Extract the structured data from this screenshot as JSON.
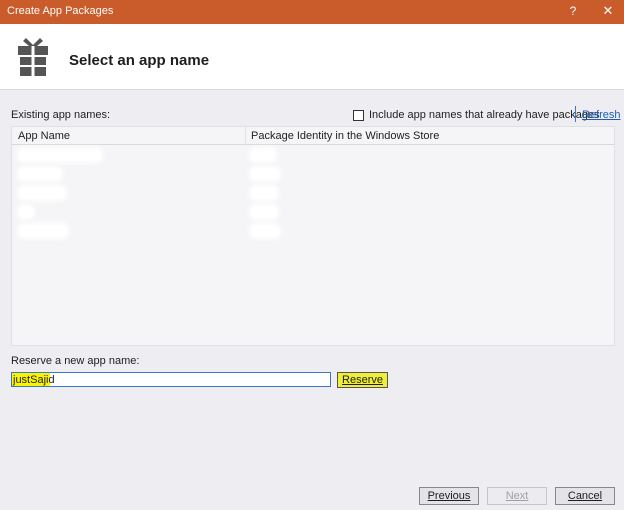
{
  "window": {
    "title": "Create App Packages",
    "help_label": "?",
    "close_label": "✕"
  },
  "header": {
    "heading": "Select an app name",
    "icon": "gift-icon"
  },
  "existing": {
    "label": "Existing app names:",
    "include_label": "Include app names that already have packages",
    "include_checked": false,
    "refresh_label": "Refresh"
  },
  "table": {
    "columns": [
      "App Name",
      "Package Identity in the Windows Store"
    ],
    "rows_count_note": "row contents obscured in screenshot"
  },
  "reserve": {
    "label": "Reserve a new app name:",
    "input_value": "justSajid",
    "button_label": "Reserve"
  },
  "footer": {
    "previous_label": "Previous",
    "next_label": "Next",
    "cancel_label": "Cancel"
  },
  "colors": {
    "titlebar": "#ca5b2b",
    "highlight": "#f0ee36",
    "link": "#1b5eb8"
  }
}
